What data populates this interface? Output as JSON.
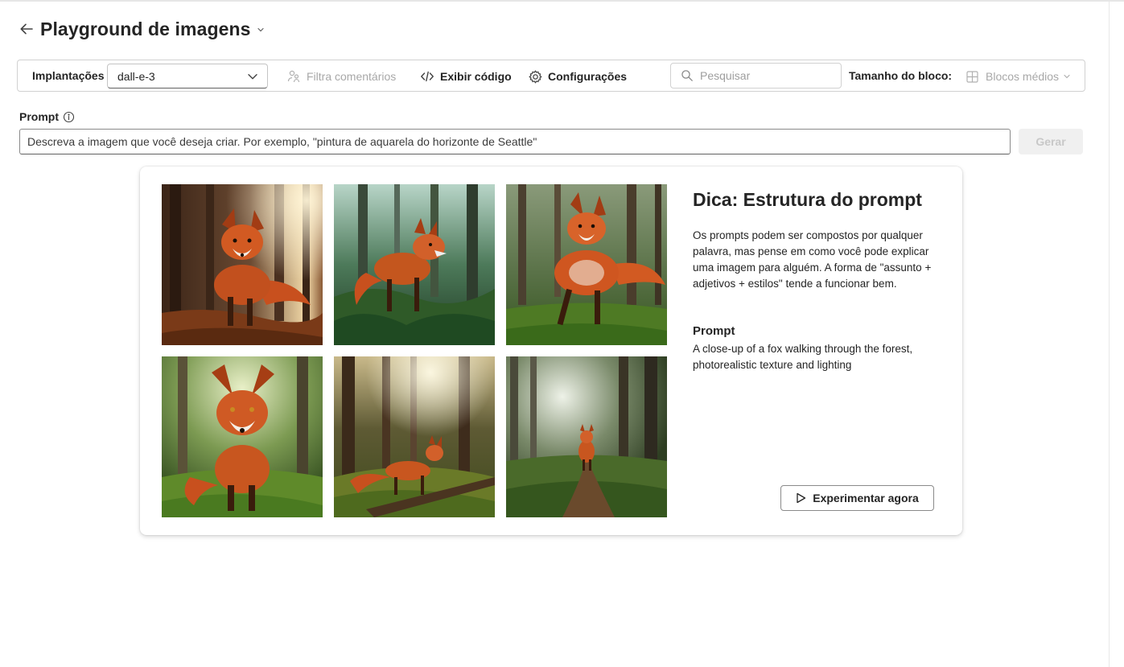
{
  "header": {
    "title": "Playground de imagens"
  },
  "toolbar": {
    "deployments_label": "Implantações",
    "deployment_selected": "dall-e-3",
    "filter_label": "Filtra comentários",
    "view_code_label": "Exibir código",
    "settings_label": "Configurações",
    "search_placeholder": "Pesquisar",
    "tile_size_label": "Tamanho do bloco:",
    "tile_size_selected": "Blocos médios"
  },
  "prompt": {
    "label": "Prompt",
    "placeholder": "Descreva a imagem que você deseja criar. Por exemplo, \"pintura de aquarela do horizonte de Seattle\"",
    "generate_label": "Gerar"
  },
  "tip": {
    "title": "Dica: Estrutura do prompt",
    "body": "Os prompts podem ser compostos por qualquer palavra, mas pense em como você pode explicar uma imagem para alguém. A forma de \"assunto + adjetivos + estilos\" tende a funcionar bem.",
    "prompt_heading": "Prompt",
    "prompt_text": "A close-up of a fox walking through the forest, photorealistic texture and lighting",
    "try_label": "Experimentar agora"
  },
  "colors": {
    "fox": "#c8501e",
    "forest_green": "#3f6b2c",
    "bark": "#4a3424"
  }
}
